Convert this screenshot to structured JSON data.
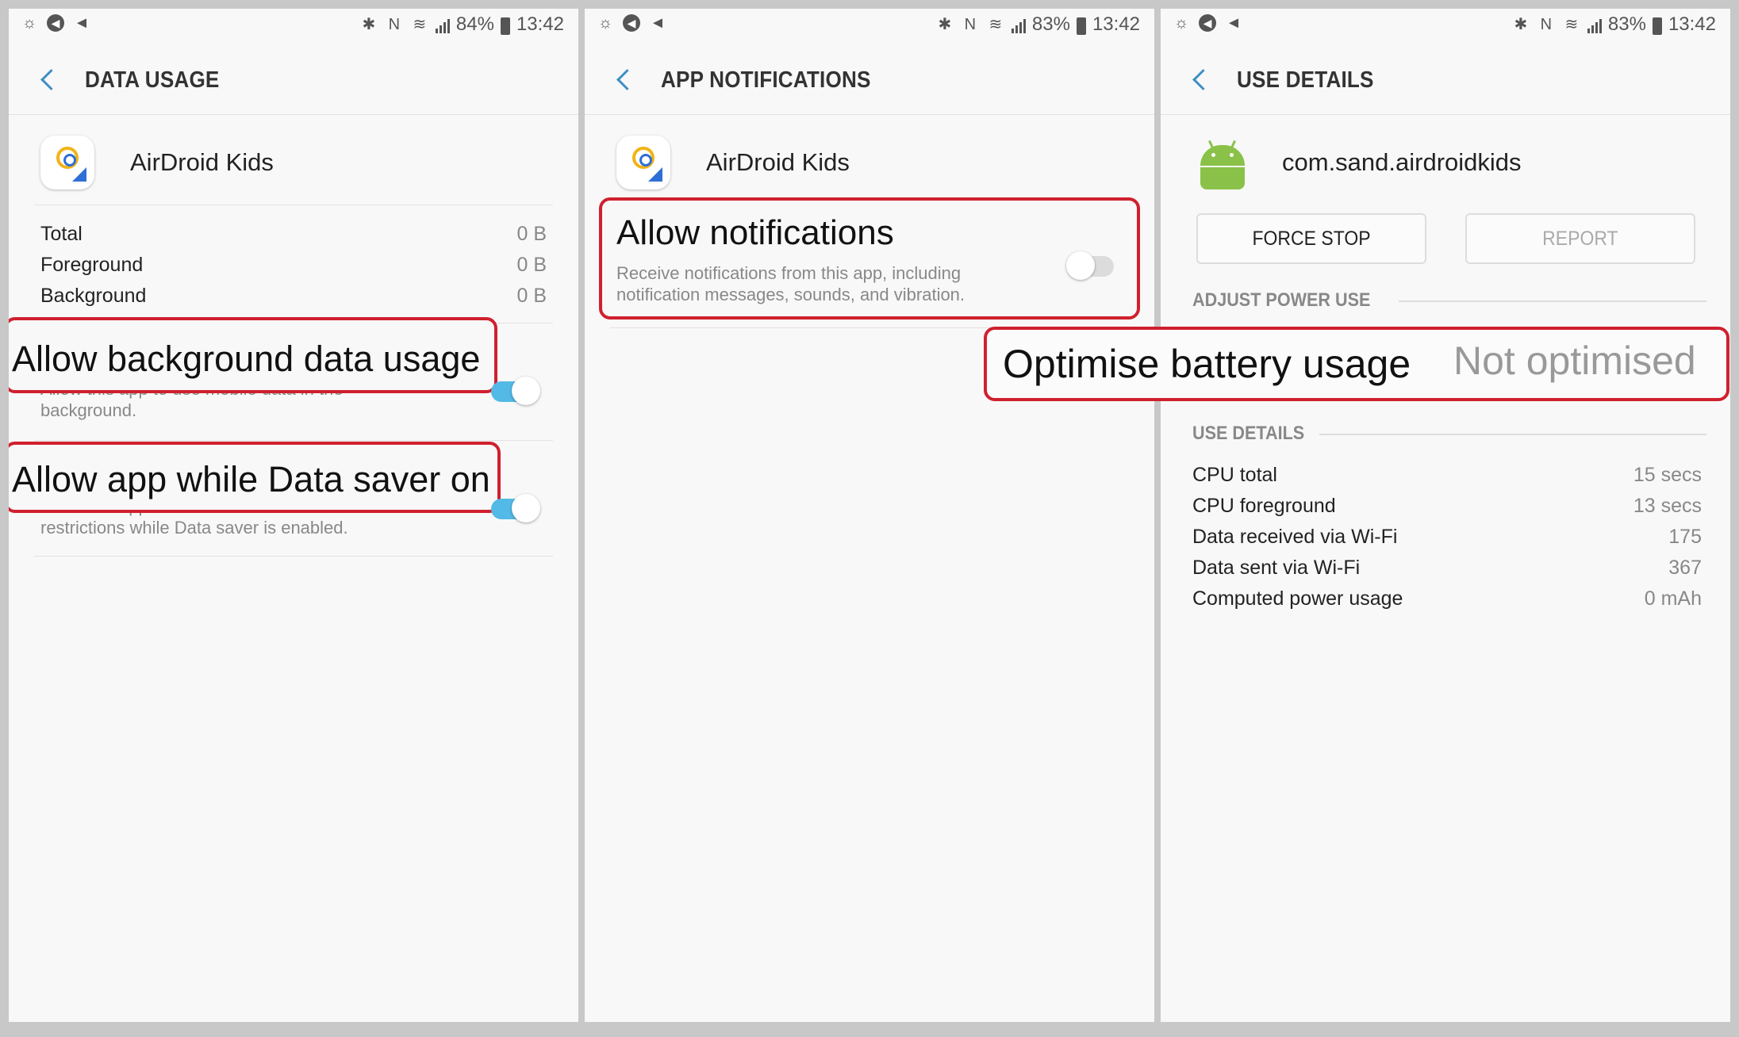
{
  "panels": [
    {
      "status": {
        "battery": "84%",
        "time": "13:42"
      },
      "title": "DATA USAGE",
      "app_name": "AirDroid Kids",
      "usage_rows": [
        {
          "label": "Total",
          "value": "0 B"
        },
        {
          "label": "Foreground",
          "value": "0 B"
        },
        {
          "label": "Background",
          "value": "0 B"
        }
      ],
      "settings": [
        {
          "title": "Allow background data usage",
          "subtitle": "Allow this app to use mobile data in the background.",
          "enabled": true
        },
        {
          "title": "Allow app while Data saver on",
          "subtitle": "Allow this app to use mobile data without restrictions while Data saver is enabled.",
          "enabled": true
        }
      ]
    },
    {
      "status": {
        "battery": "83%",
        "time": "13:42"
      },
      "title": "APP NOTIFICATIONS",
      "app_name": "AirDroid Kids",
      "setting": {
        "title": "Allow notifications",
        "subtitle": "Receive notifications from this app, including notification messages, sounds, and vibration.",
        "enabled": false
      }
    },
    {
      "status": {
        "battery": "83%",
        "time": "13:42"
      },
      "title": "USE DETAILS",
      "package_name": "com.sand.airdroidkids",
      "buttons": {
        "force_stop": "FORCE STOP",
        "report": "REPORT"
      },
      "section_power": "ADJUST POWER USE",
      "optimise": {
        "label": "Optimise battery usage",
        "value": "Not optimised"
      },
      "section_details": "USE DETAILS",
      "details": [
        {
          "label": "CPU total",
          "value": "15 secs"
        },
        {
          "label": "CPU foreground",
          "value": "13 secs"
        },
        {
          "label": "Data received via Wi-Fi",
          "value": "175"
        },
        {
          "label": "Data sent via Wi-Fi",
          "value": "367"
        },
        {
          "label": "Computed power usage",
          "value": "0 mAh"
        }
      ]
    }
  ],
  "colors": {
    "accent": "#53b9e6",
    "highlight": "#d0202e",
    "android": "#8ac249"
  },
  "icons": [
    "brightness-icon",
    "location-icon",
    "send-icon",
    "bluetooth-icon",
    "nfc-icon",
    "wifi-icon",
    "signal-icon",
    "battery-icon",
    "back-icon",
    "app-icon",
    "android-icon"
  ]
}
